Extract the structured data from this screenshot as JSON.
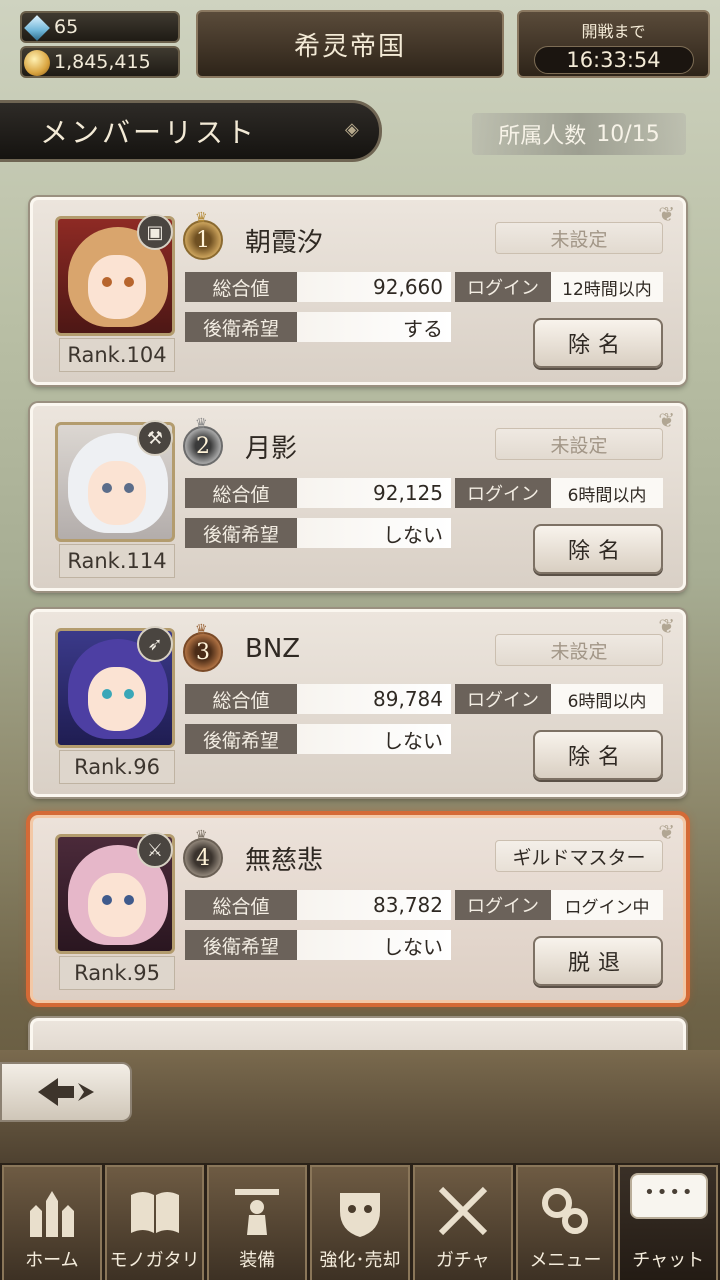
{
  "currency": {
    "gems": "65",
    "coins": "1,845,415"
  },
  "guild": {
    "name": "希灵帝国"
  },
  "war": {
    "label": "開戦まで",
    "timer": "16:33:54"
  },
  "list": {
    "title": "メンバーリスト",
    "count_label": "所属人数",
    "count": "10/15"
  },
  "labels": {
    "total": "総合値",
    "rear": "後衛希望",
    "login": "ログイン"
  },
  "members": [
    {
      "rank_pos": "1",
      "name": "朝霞汐",
      "role": "未設定",
      "total": "92,660",
      "login": "12時間以内",
      "rear": "する",
      "rank": "Rank.104",
      "action": "除名",
      "class_icon": "grimoire-icon"
    },
    {
      "rank_pos": "2",
      "name": "月影",
      "role": "未設定",
      "total": "92,125",
      "login": "6時間以内",
      "rear": "しない",
      "rank": "Rank.114",
      "action": "除名",
      "class_icon": "hammer-icon"
    },
    {
      "rank_pos": "3",
      "name": "BNZ",
      "role": "未設定",
      "total": "89,784",
      "login": "6時間以内",
      "rear": "しない",
      "rank": "Rank.96",
      "action": "除名",
      "class_icon": "bow-icon"
    },
    {
      "rank_pos": "4",
      "name": "無慈悲",
      "role": "ギルドマスター",
      "total": "83,782",
      "login": "ログイン中",
      "rear": "しない",
      "rank": "Rank.95",
      "action": "脱退",
      "class_icon": "sword-icon"
    }
  ],
  "nav": [
    {
      "label": "ホーム",
      "icon": "castle-icon"
    },
    {
      "label": "モノガタリ",
      "icon": "book-icon"
    },
    {
      "label": "装備",
      "icon": "puppet-icon"
    },
    {
      "label": "強化･売却",
      "icon": "mask-icon"
    },
    {
      "label": "ガチャ",
      "icon": "crossed-swords-icon"
    },
    {
      "label": "メニュー",
      "icon": "gears-icon"
    },
    {
      "label": "チャット",
      "icon": "chat-bubble-icon"
    }
  ],
  "colors": {
    "accent_master": "#d46a36",
    "label_bg": "#6b625a",
    "nav_bg": "#2a2118"
  }
}
